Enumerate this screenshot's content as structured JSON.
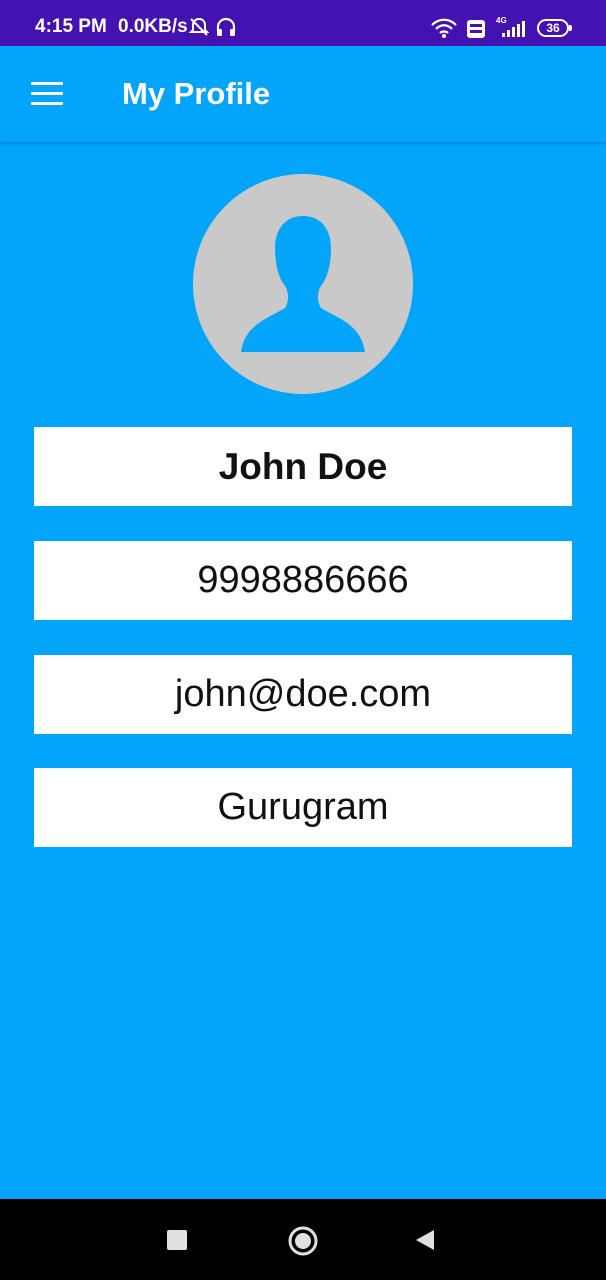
{
  "status_bar": {
    "time": "4:15 PM",
    "network_speed": "0.0KB/s",
    "battery_level": "36",
    "icons": [
      "mute-icon",
      "headphones-icon",
      "wifi-icon",
      "volte-icon",
      "signal-4g-icon",
      "battery-icon"
    ]
  },
  "app_bar": {
    "title": "My Profile",
    "menu_icon": "hamburger-menu-icon"
  },
  "profile": {
    "avatar_icon": "user-silhouette-icon",
    "name": "John Doe",
    "phone": "9998886666",
    "email": "john@doe.com",
    "city": "Gurugram"
  },
  "nav_bar": {
    "buttons": [
      "recents-button",
      "home-button",
      "back-button"
    ]
  },
  "colors": {
    "status_bar": "#4312b0",
    "primary": "#03a5fb",
    "card": "#ffffff",
    "avatar_bg": "#c9c9c9"
  }
}
